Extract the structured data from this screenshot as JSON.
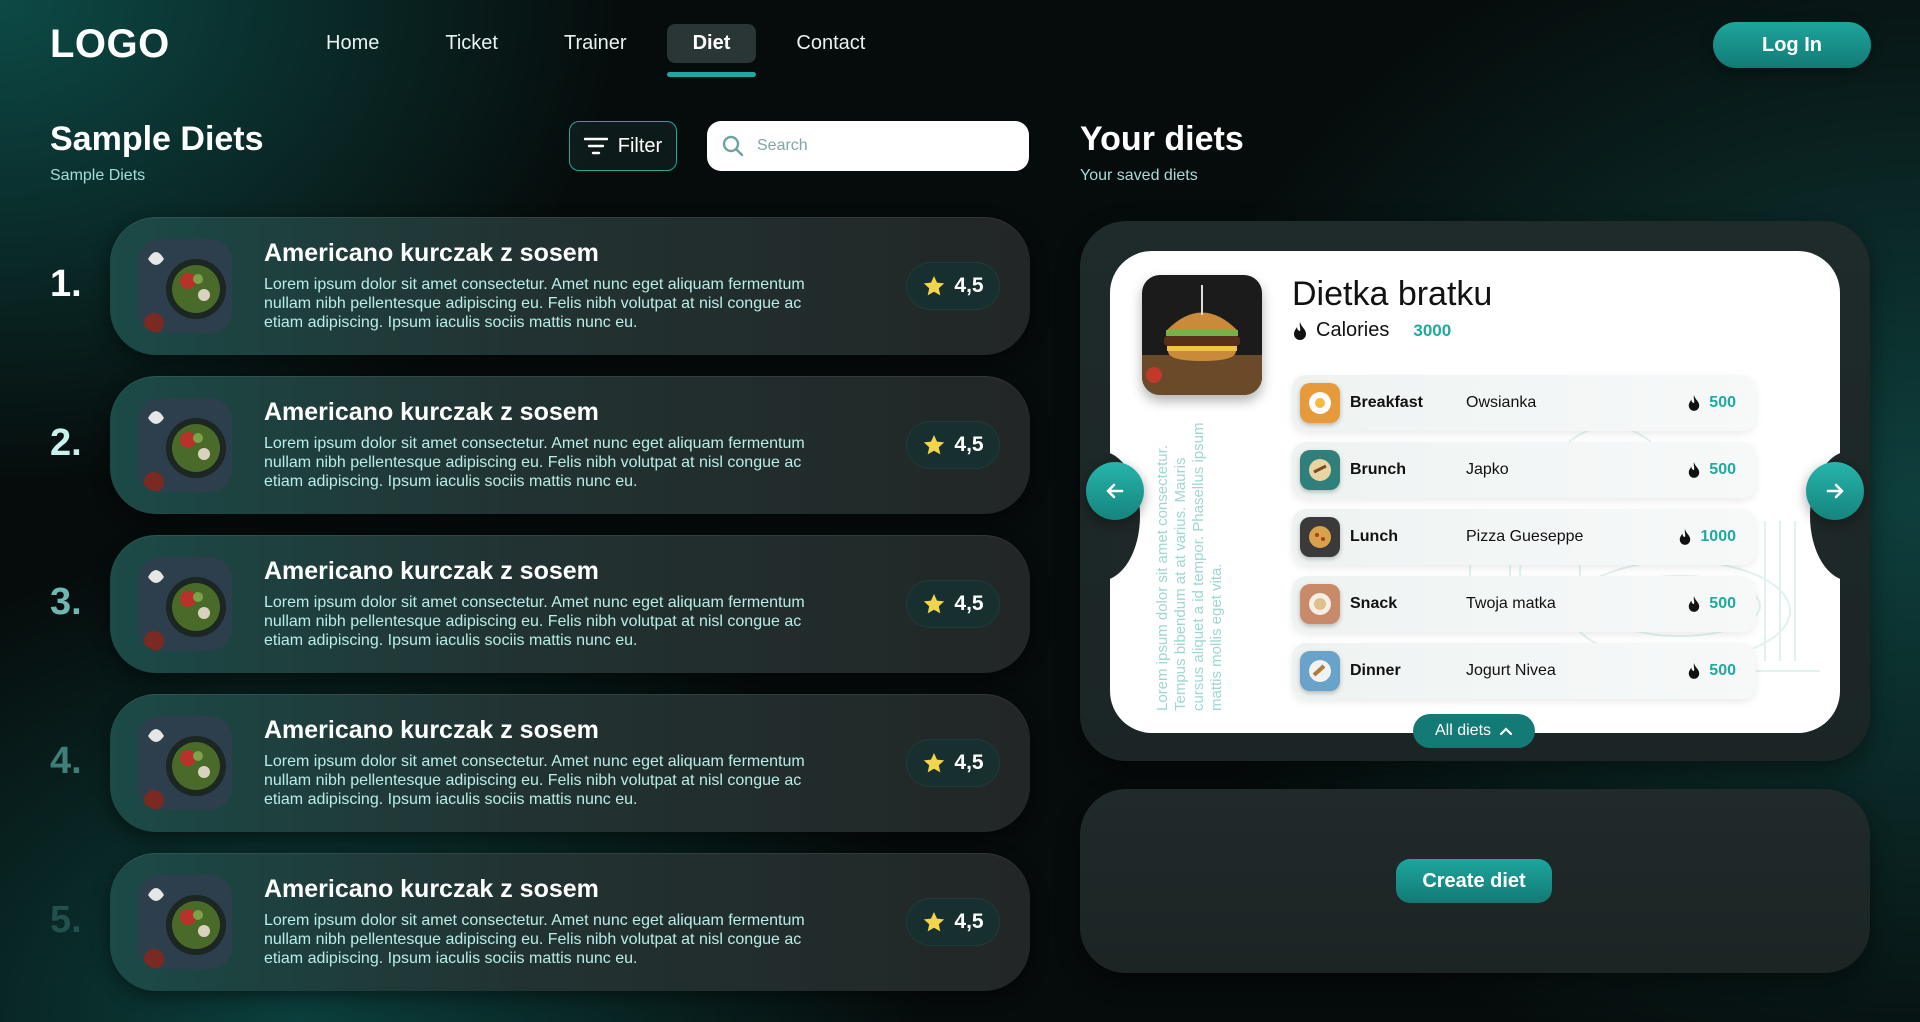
{
  "nav": {
    "logo": "LOGO",
    "items": [
      {
        "label": "Home"
      },
      {
        "label": "Ticket"
      },
      {
        "label": "Trainer"
      },
      {
        "label": "Diet",
        "active": true
      },
      {
        "label": "Contact"
      }
    ],
    "login_label": "Log In"
  },
  "sample": {
    "title": "Sample Diets",
    "subtitle": "Sample Diets",
    "filter_label": "Filter",
    "search_placeholder": "Search",
    "items": [
      {
        "rank": "1.",
        "title": "Americano kurczak z sosem",
        "description": "Lorem ipsum dolor sit amet consectetur. Amet nunc eget aliquam fermentum nullam nibh pellentesque adipiscing eu. Felis nibh volutpat at nisl congue ac etiam adipiscing. Ipsum iaculis sociis mattis nunc eu.",
        "rating": "4,5"
      },
      {
        "rank": "2.",
        "title": "Americano kurczak z sosem",
        "description": "Lorem ipsum dolor sit amet consectetur. Amet nunc eget aliquam fermentum nullam nibh pellentesque adipiscing eu. Felis nibh volutpat at nisl congue ac etiam adipiscing. Ipsum iaculis sociis mattis nunc eu.",
        "rating": "4,5"
      },
      {
        "rank": "3.",
        "title": "Americano kurczak z sosem",
        "description": "Lorem ipsum dolor sit amet consectetur. Amet nunc eget aliquam fermentum nullam nibh pellentesque adipiscing eu. Felis nibh volutpat at nisl congue ac etiam adipiscing. Ipsum iaculis sociis mattis nunc eu.",
        "rating": "4,5"
      },
      {
        "rank": "4.",
        "title": "Americano kurczak z sosem",
        "description": "Lorem ipsum dolor sit amet consectetur. Amet nunc eget aliquam fermentum nullam nibh pellentesque adipiscing eu. Felis nibh volutpat at nisl congue ac etiam adipiscing. Ipsum iaculis sociis mattis nunc eu.",
        "rating": "4,5"
      },
      {
        "rank": "5.",
        "title": "Americano kurczak z sosem",
        "description": "Lorem ipsum dolor sit amet consectetur. Amet nunc eget aliquam fermentum nullam nibh pellentesque adipiscing eu. Felis nibh volutpat at nisl congue ac etiam adipiscing. Ipsum iaculis sociis mattis nunc eu.",
        "rating": "4,5"
      }
    ]
  },
  "yours": {
    "title": "Your diets",
    "subtitle": "Your saved diets",
    "card": {
      "name": "Dietka bratku",
      "calories_label": "Calories",
      "calories_value": "3000",
      "side_text": "Lorem ipsum dolor sit amet consectetur. Tempus bibendum at at varius. Mauris cursus aliquet a id tempor. Phasellus ipsum mattis mollis eget vita.",
      "meals": [
        {
          "name": "Breakfast",
          "food": "Owsianka",
          "kcal": "500"
        },
        {
          "name": "Brunch",
          "food": "Japko",
          "kcal": "500"
        },
        {
          "name": "Lunch",
          "food": "Pizza Gueseppe",
          "kcal": "1000"
        },
        {
          "name": "Snack",
          "food": "Twoja matka",
          "kcal": "500"
        },
        {
          "name": "Dinner",
          "food": "Jogurt Nivea",
          "kcal": "500"
        }
      ]
    },
    "all_diets_label": "All diets",
    "create_label": "Create diet"
  },
  "colors": {
    "accent": "#1ea9a1",
    "star": "#f2d54a",
    "card_bg": "#ffffff"
  }
}
